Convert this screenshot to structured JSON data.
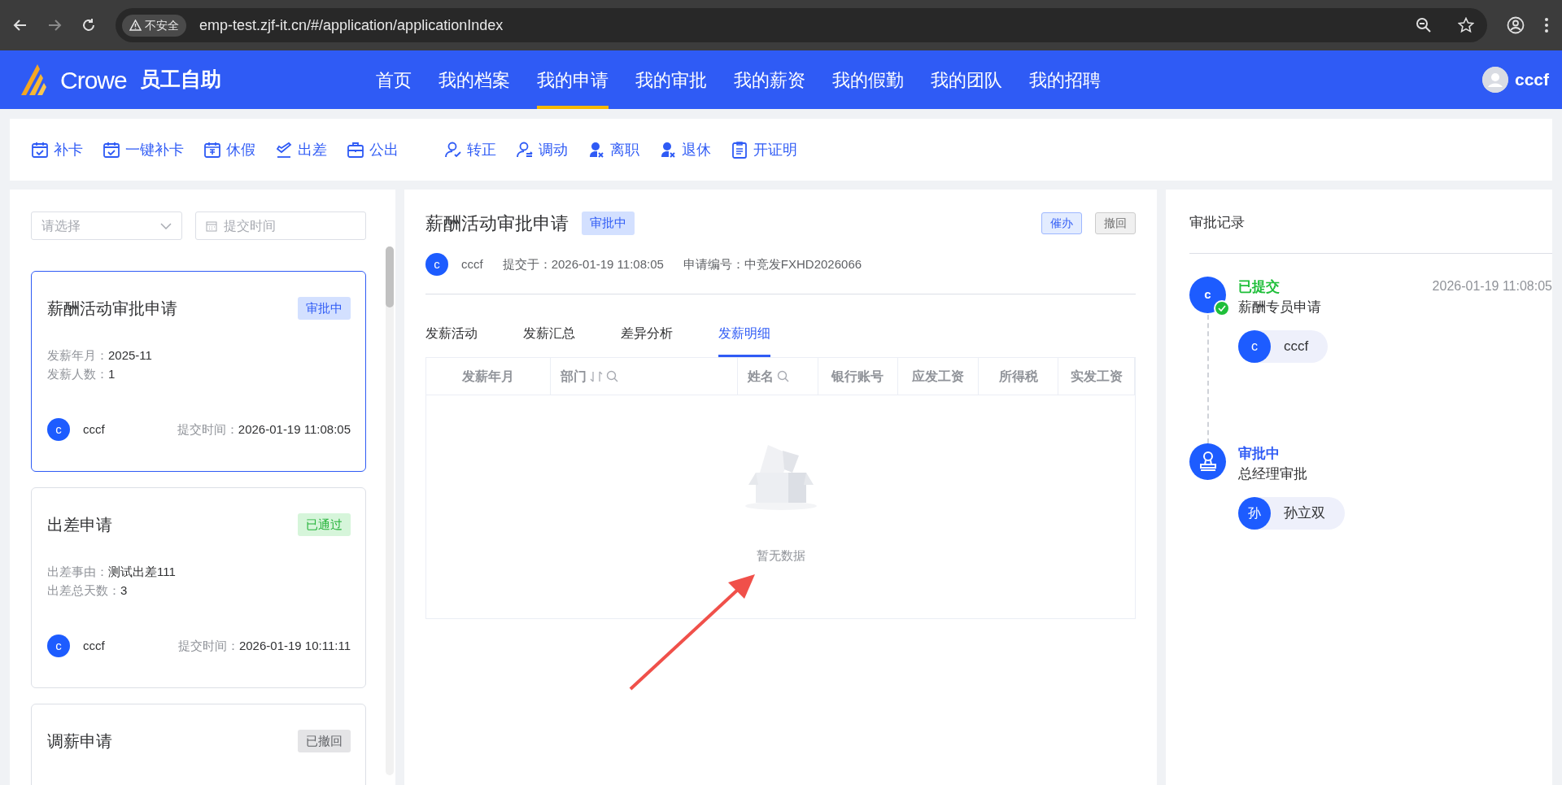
{
  "browser": {
    "security_label": "不安全",
    "url": "emp-test.zjf-it.cn/#/application/applicationIndex"
  },
  "header": {
    "brand": "Crowe",
    "app_name": "员工自助",
    "nav": [
      {
        "label": "首页",
        "selected": false
      },
      {
        "label": "我的档案",
        "selected": false
      },
      {
        "label": "我的申请",
        "selected": true
      },
      {
        "label": "我的审批",
        "selected": false
      },
      {
        "label": "我的薪资",
        "selected": false
      },
      {
        "label": "我的假勤",
        "selected": false
      },
      {
        "label": "我的团队",
        "selected": false
      },
      {
        "label": "我的招聘",
        "selected": false
      }
    ],
    "user": "cccf"
  },
  "toolbar": {
    "groups": [
      [
        {
          "label": "补卡"
        },
        {
          "label": "一键补卡"
        },
        {
          "label": "休假"
        },
        {
          "label": "出差"
        },
        {
          "label": "公出"
        }
      ],
      [
        {
          "label": "转正"
        },
        {
          "label": "调动"
        },
        {
          "label": "离职"
        },
        {
          "label": "退休"
        },
        {
          "label": "开证明"
        }
      ]
    ]
  },
  "filters": {
    "select_placeholder": "请选择",
    "date_placeholder": "提交时间"
  },
  "applications": [
    {
      "title": "薪酬活动审批申请",
      "status": "审批中",
      "kind": "pending",
      "selected": true,
      "fields": [
        {
          "label": "发薪年月：",
          "value": "2025-11"
        },
        {
          "label": "发薪人数：",
          "value": "1"
        }
      ],
      "avatar": "c",
      "user": "cccf",
      "time_label": "提交时间：",
      "time": "2026-01-19 11:08:05"
    },
    {
      "title": "出差申请",
      "status": "已通过",
      "kind": "approved",
      "selected": false,
      "fields": [
        {
          "label": "出差事由：",
          "value": "测试出差111"
        },
        {
          "label": "出差总天数：",
          "value": "3"
        }
      ],
      "avatar": "c",
      "user": "cccf",
      "time_label": "提交时间：",
      "time": "2026-01-19 10:11:11"
    },
    {
      "title": "调薪申请",
      "status": "已撤回",
      "kind": "withdrawn",
      "selected": false
    }
  ],
  "detail": {
    "title": "薪酬活动审批申请",
    "status": "审批中",
    "actions": [
      {
        "label": "催办",
        "kind": "primary"
      },
      {
        "label": "撤回",
        "kind": "default"
      }
    ],
    "avatar": "c",
    "user": "cccf",
    "submitted": "提交于：2026-01-19 11:08:05",
    "number": "申请编号：中竞发FXHD2026066",
    "tabs": [
      {
        "label": "发薪活动",
        "selected": false
      },
      {
        "label": "发薪汇总",
        "selected": false
      },
      {
        "label": "差异分析",
        "selected": false
      },
      {
        "label": "发薪明细",
        "selected": true
      }
    ],
    "table": {
      "columns": [
        {
          "label": "发薪年月",
          "sortable": false,
          "searchable": false
        },
        {
          "label": "部门",
          "sortable": true,
          "searchable": true
        },
        {
          "label": "姓名",
          "sortable": false,
          "searchable": true
        },
        {
          "label": "银行账号",
          "sortable": false,
          "searchable": false
        },
        {
          "label": "应发工资",
          "sortable": false,
          "searchable": false
        },
        {
          "label": "所得税",
          "sortable": false,
          "searchable": false
        },
        {
          "label": "实发工资",
          "sortable": false,
          "searchable": false
        }
      ],
      "empty_text": "暂无数据"
    }
  },
  "records": {
    "title": "审批记录",
    "steps": [
      {
        "status": "已提交",
        "kind": "done",
        "node_letter": "c",
        "name": "薪酬专员申请",
        "time": "2026-01-19 11:08:05",
        "approvers": [
          {
            "avatar": "c",
            "name": "cccf"
          }
        ]
      },
      {
        "status": "审批中",
        "kind": "pending",
        "name": "总经理审批",
        "approvers": [
          {
            "avatar": "孙",
            "name": "孙立双"
          }
        ]
      }
    ]
  }
}
